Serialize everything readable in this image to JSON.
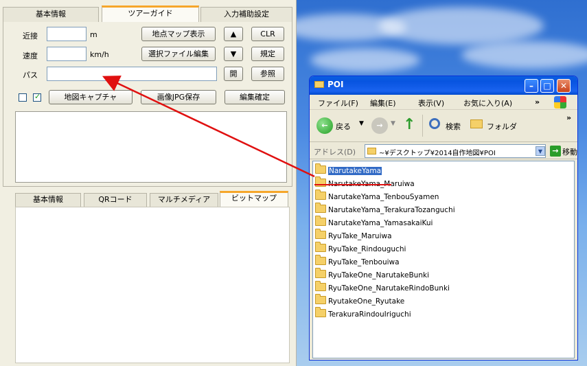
{
  "left_tabs": [
    "基本情報",
    "ツアーガイド",
    "入力補助設定"
  ],
  "form": {
    "near_label": "近接",
    "near_unit": "m",
    "near_value": "",
    "speed_label": "速度",
    "speed_unit": "km/h",
    "speed_value": "",
    "path_label": "パス",
    "path_value": "",
    "btn_map_display": "地点マップ表示",
    "btn_up": "▲",
    "btn_clr": "CLR",
    "btn_select_file": "選択ファイル編集",
    "btn_down": "▼",
    "btn_specify": "規定",
    "btn_open": "開",
    "btn_browse": "参照",
    "btn_map_capture": "地図キャプチャ",
    "btn_save_jpg": "画像JPG保存",
    "btn_edit_confirm": "編集確定"
  },
  "bottom_tabs": [
    "基本情報",
    "QRコード",
    "マルチメディア",
    "ビットマップ"
  ],
  "explorer": {
    "title": "POI",
    "menu": [
      "ファイル(F)",
      "編集(E)",
      "表示(V)",
      "お気に入り(A)",
      "»"
    ],
    "back_label": "戻る",
    "search_label": "検索",
    "folder_label": "フォルダ",
    "address_label": "アドレス(D)",
    "address_value": "~¥デスクトップ¥2014自作地図¥POI",
    "go_label": "移動",
    "files": [
      "NarutakeYama",
      "NarutakeYama_Maruiwa",
      "NarutakeYama_TenbouSyamen",
      "NarutakeYama_TerakuraTozanguchi",
      "NarutakeYama_YamasakaiKui",
      "RyuTake_Maruiwa",
      "RyuTake_Rindouguchi",
      "RyuTake_Tenbouiwa",
      "RyuTakeOne_NarutakeBunki",
      "RyuTakeOne_NarutakeRindoBunki",
      "RyutakeOne_Ryutake",
      "TerakuraRindouIriguchi"
    ],
    "selected_index": 0
  },
  "colors": {
    "arrow": "#e01010",
    "selection": "#316ac5",
    "tab_accent": "#f6a62a"
  }
}
